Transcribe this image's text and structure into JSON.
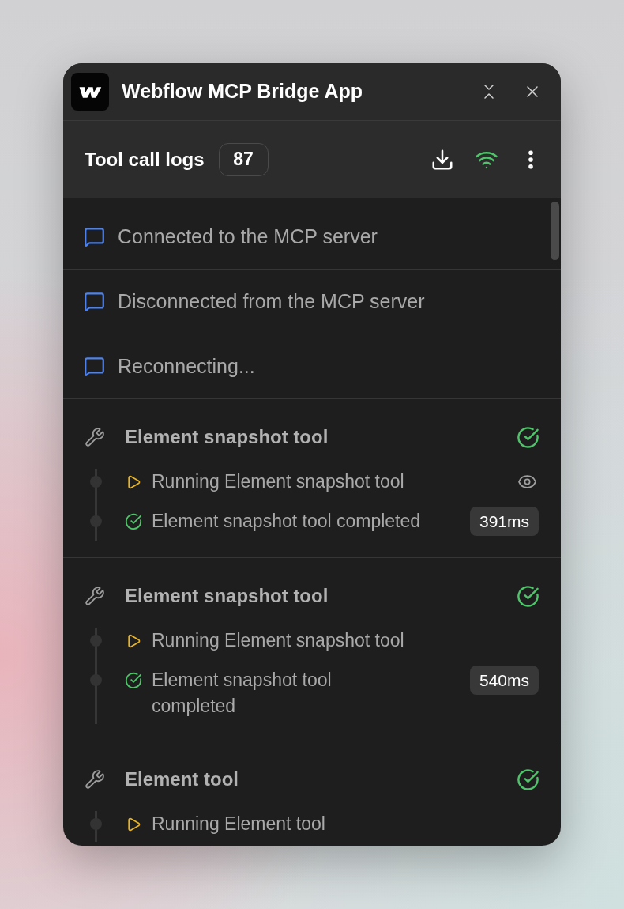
{
  "window": {
    "title": "Webflow MCP Bridge App"
  },
  "header": {
    "title": "Tool call logs",
    "count": "87",
    "connected": true
  },
  "logs": [
    {
      "kind": "message",
      "text": "Connected to the MCP server"
    },
    {
      "kind": "message",
      "text": "Disconnected from the MCP server"
    },
    {
      "kind": "message",
      "text": "Reconnecting..."
    },
    {
      "kind": "tool",
      "title": "Element snapshot tool",
      "completed": true,
      "steps": [
        {
          "kind": "running",
          "text": "Running Element snapshot tool",
          "previewable": true
        },
        {
          "kind": "completed",
          "text": "Element snapshot tool completed",
          "duration": "391ms",
          "previewable": false
        }
      ]
    },
    {
      "kind": "tool",
      "title": "Element snapshot tool",
      "completed": true,
      "steps": [
        {
          "kind": "running",
          "text": "Running Element snapshot tool",
          "previewable": false
        },
        {
          "kind": "completed",
          "text": "Element snapshot tool completed",
          "duration": "540ms",
          "previewable": false
        }
      ]
    },
    {
      "kind": "tool",
      "title": "Element tool",
      "completed": true,
      "steps": [
        {
          "kind": "running",
          "text": "Running Element tool",
          "previewable": false
        }
      ]
    }
  ]
}
